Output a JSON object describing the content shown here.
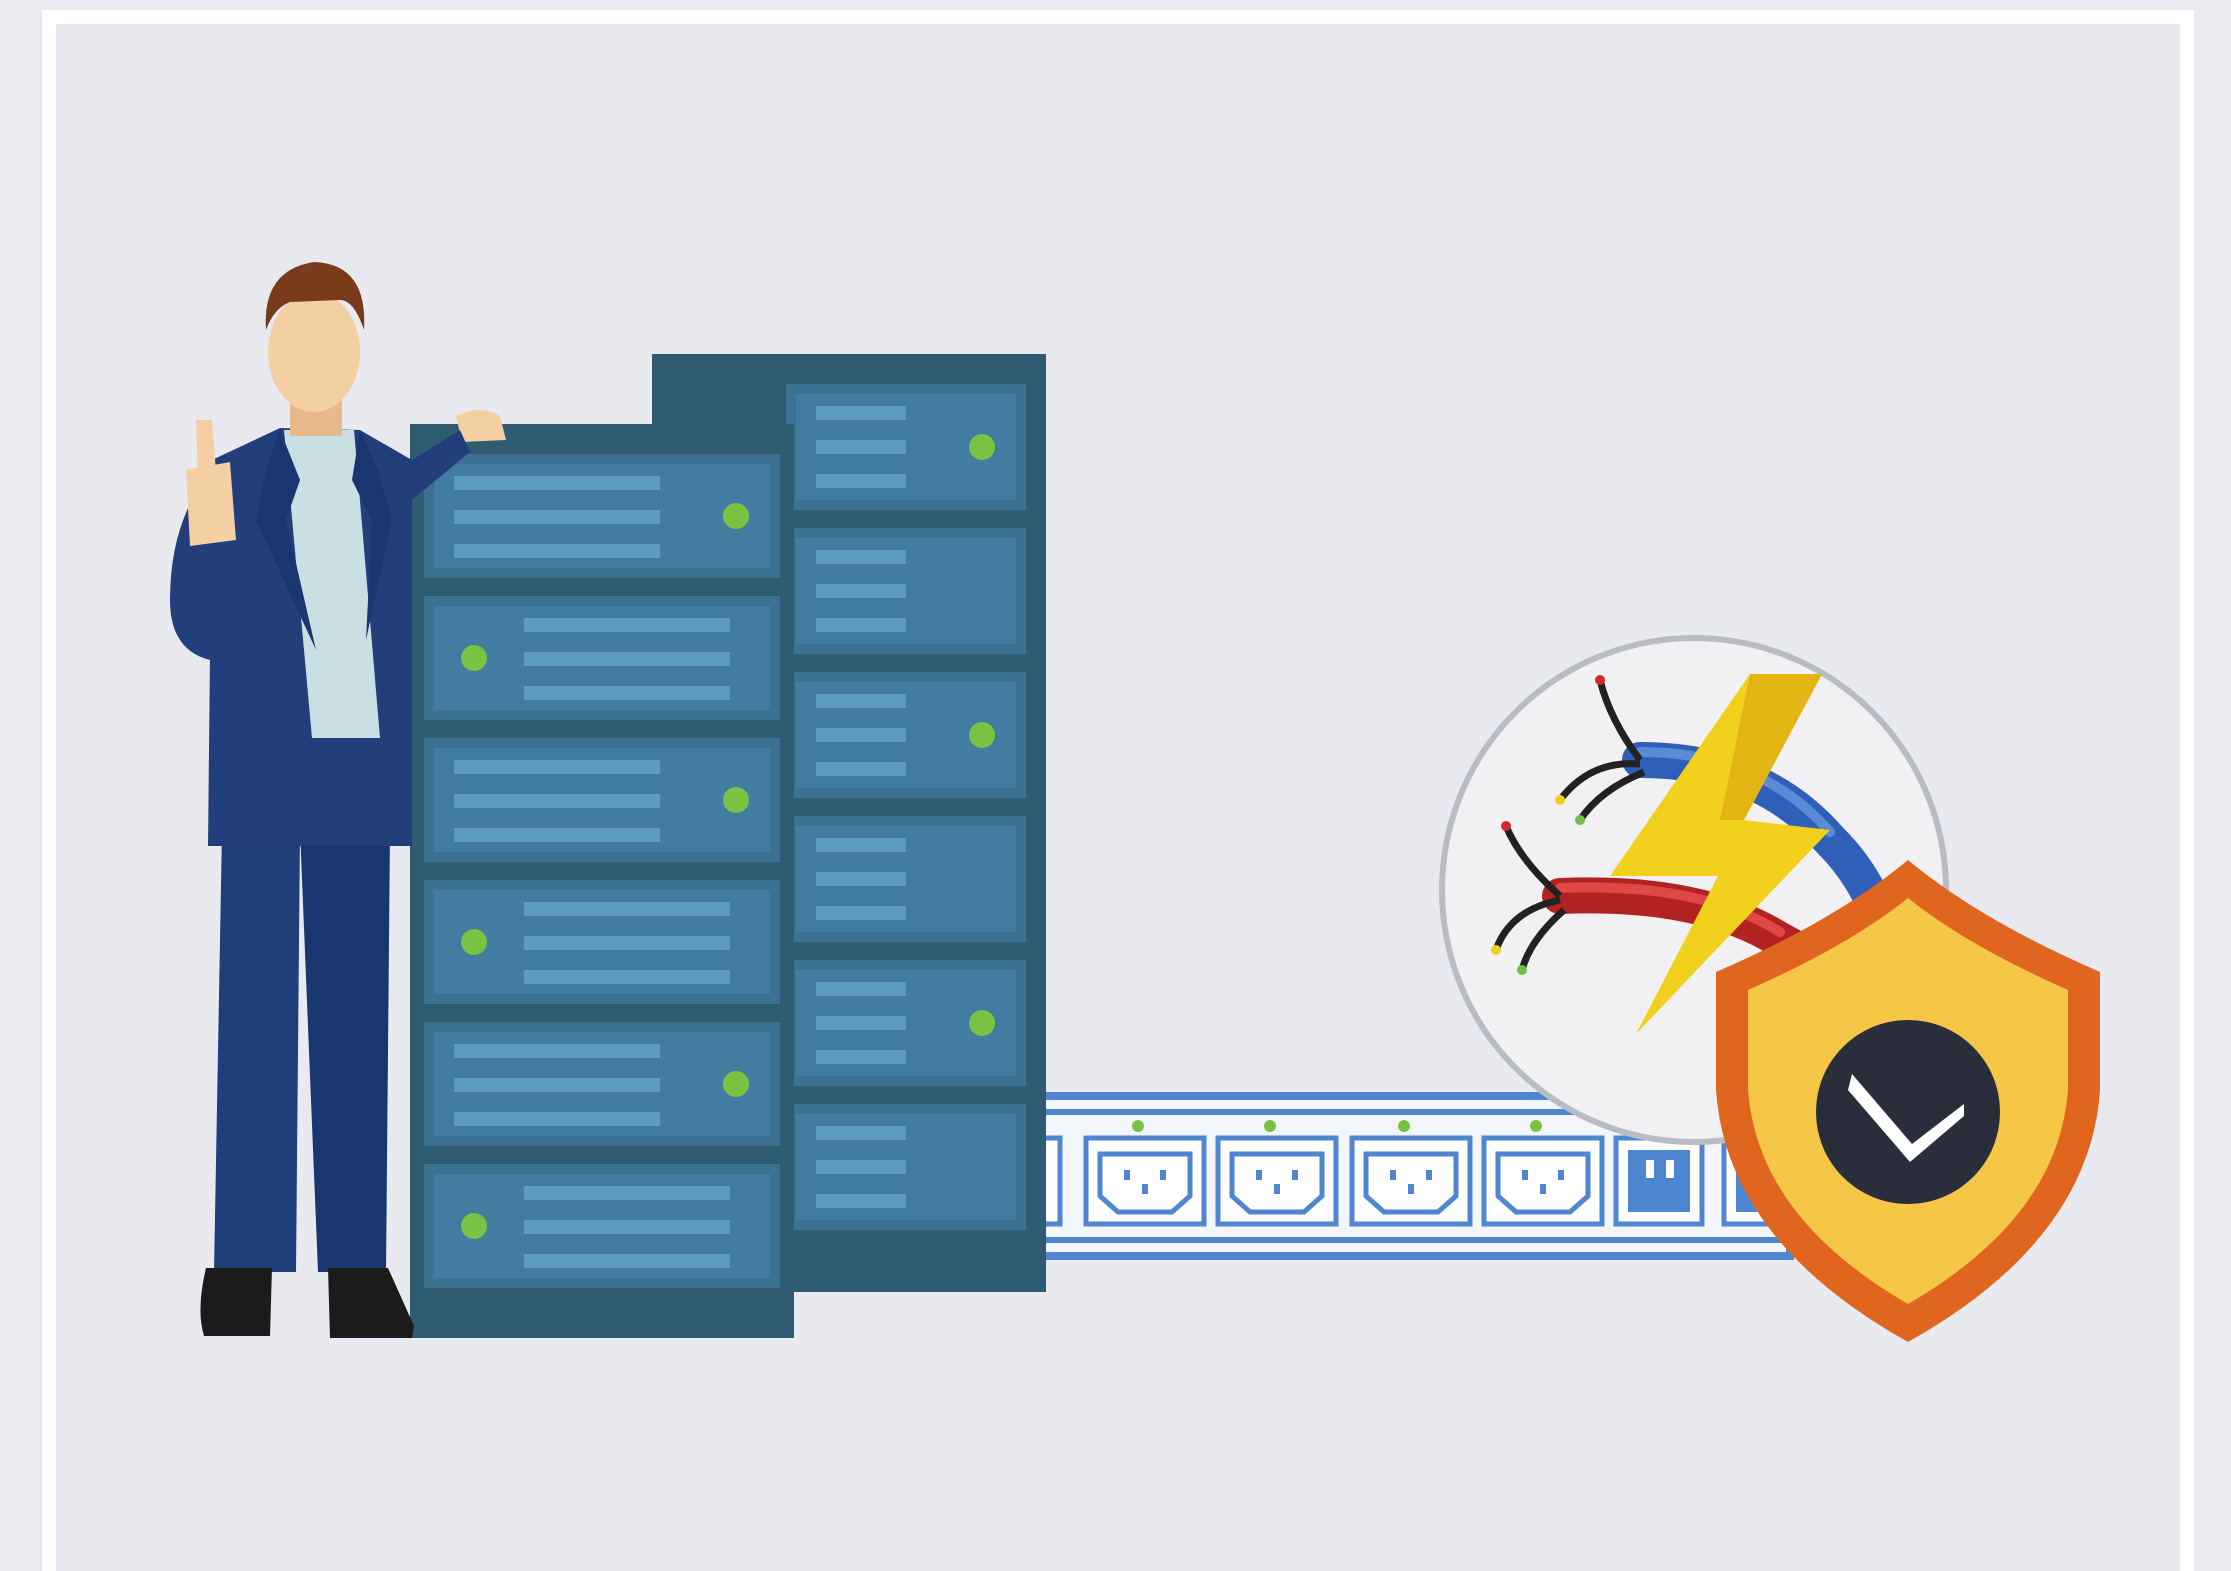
{
  "illustration": {
    "colors": {
      "background": "#e8eaf0",
      "frame": "#ffffff",
      "rack_dark": "#2f5b73",
      "rack_mid": "#3c7192",
      "rack_slot": "#4a86a8",
      "rack_line": "#5c9cc2",
      "status_led": "#7cc242",
      "suit": "#1f3f7a",
      "shirt": "#c9dfe4",
      "skin": "#f3cfa3",
      "hair": "#7a3b1b",
      "power_strip": "#4f86cf",
      "shield_outer": "#e0651f",
      "shield_inner": "#f6c646",
      "clock_face": "#2a2d3a",
      "bolt": "#f2d01e",
      "wire_blue": "#3f6fc4",
      "wire_red": "#c12a2a"
    },
    "icons": [
      "businessman-thumbs-up-icon",
      "server-rack-icon",
      "power-strip-icon",
      "electric-wires-icon",
      "lightning-bolt-icon",
      "security-shield-icon",
      "clock-icon"
    ]
  }
}
